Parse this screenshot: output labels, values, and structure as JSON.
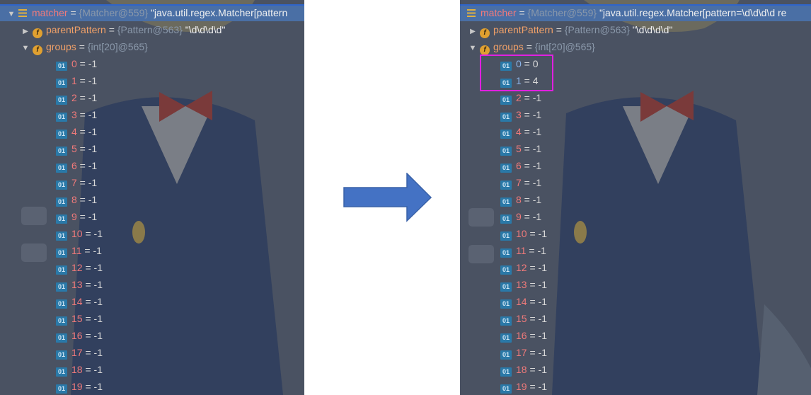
{
  "left": {
    "matcher": {
      "name": "matcher",
      "eq": " = ",
      "ref": "{Matcher@559}",
      "str": "\"java.util.regex.Matcher[pattern"
    },
    "parentPattern": {
      "name": "parentPattern",
      "eq": " = ",
      "ref": "{Pattern@563}",
      "str": "\"\\d\\d\\d\\d\""
    },
    "groups": {
      "name": "groups",
      "eq": " = ",
      "ref": "{int[20]@565}"
    },
    "items": [
      {
        "index": "0",
        "value": "-1"
      },
      {
        "index": "1",
        "value": "-1"
      },
      {
        "index": "2",
        "value": "-1"
      },
      {
        "index": "3",
        "value": "-1"
      },
      {
        "index": "4",
        "value": "-1"
      },
      {
        "index": "5",
        "value": "-1"
      },
      {
        "index": "6",
        "value": "-1"
      },
      {
        "index": "7",
        "value": "-1"
      },
      {
        "index": "8",
        "value": "-1"
      },
      {
        "index": "9",
        "value": "-1"
      },
      {
        "index": "10",
        "value": "-1"
      },
      {
        "index": "11",
        "value": "-1"
      },
      {
        "index": "12",
        "value": "-1"
      },
      {
        "index": "13",
        "value": "-1"
      },
      {
        "index": "14",
        "value": "-1"
      },
      {
        "index": "15",
        "value": "-1"
      },
      {
        "index": "16",
        "value": "-1"
      },
      {
        "index": "17",
        "value": "-1"
      },
      {
        "index": "18",
        "value": "-1"
      },
      {
        "index": "19",
        "value": "-1"
      }
    ]
  },
  "right": {
    "matcher": {
      "name": "matcher",
      "eq": " = ",
      "ref": "{Matcher@559}",
      "str": "\"java.util.regex.Matcher[pattern=\\d\\d\\d\\d re"
    },
    "parentPattern": {
      "name": "parentPattern",
      "eq": " = ",
      "ref": "{Pattern@563}",
      "str": "\"\\d\\d\\d\\d\""
    },
    "groups": {
      "name": "groups",
      "eq": " = ",
      "ref": "{int[20]@565}"
    },
    "items": [
      {
        "index": "0",
        "value": "0"
      },
      {
        "index": "1",
        "value": "4"
      },
      {
        "index": "2",
        "value": "-1"
      },
      {
        "index": "3",
        "value": "-1"
      },
      {
        "index": "4",
        "value": "-1"
      },
      {
        "index": "5",
        "value": "-1"
      },
      {
        "index": "6",
        "value": "-1"
      },
      {
        "index": "7",
        "value": "-1"
      },
      {
        "index": "8",
        "value": "-1"
      },
      {
        "index": "9",
        "value": "-1"
      },
      {
        "index": "10",
        "value": "-1"
      },
      {
        "index": "11",
        "value": "-1"
      },
      {
        "index": "12",
        "value": "-1"
      },
      {
        "index": "13",
        "value": "-1"
      },
      {
        "index": "14",
        "value": "-1"
      },
      {
        "index": "15",
        "value": "-1"
      },
      {
        "index": "16",
        "value": "-1"
      },
      {
        "index": "17",
        "value": "-1"
      },
      {
        "index": "18",
        "value": "-1"
      },
      {
        "index": "19",
        "value": "-1"
      }
    ]
  },
  "icons": {
    "expanded": "triangle-down-icon",
    "collapsed": "triangle-right-icon",
    "field": "field-f-icon",
    "object": "object-equals-icon",
    "primitive": "int-01-icon",
    "field_glyph": "f",
    "primitive_glyph": "01",
    "transition": "arrow-right-icon"
  },
  "colors": {
    "selected_row": "#4a6fa5",
    "highlight_box": "#e020e0",
    "arrow": "#4472c4"
  }
}
